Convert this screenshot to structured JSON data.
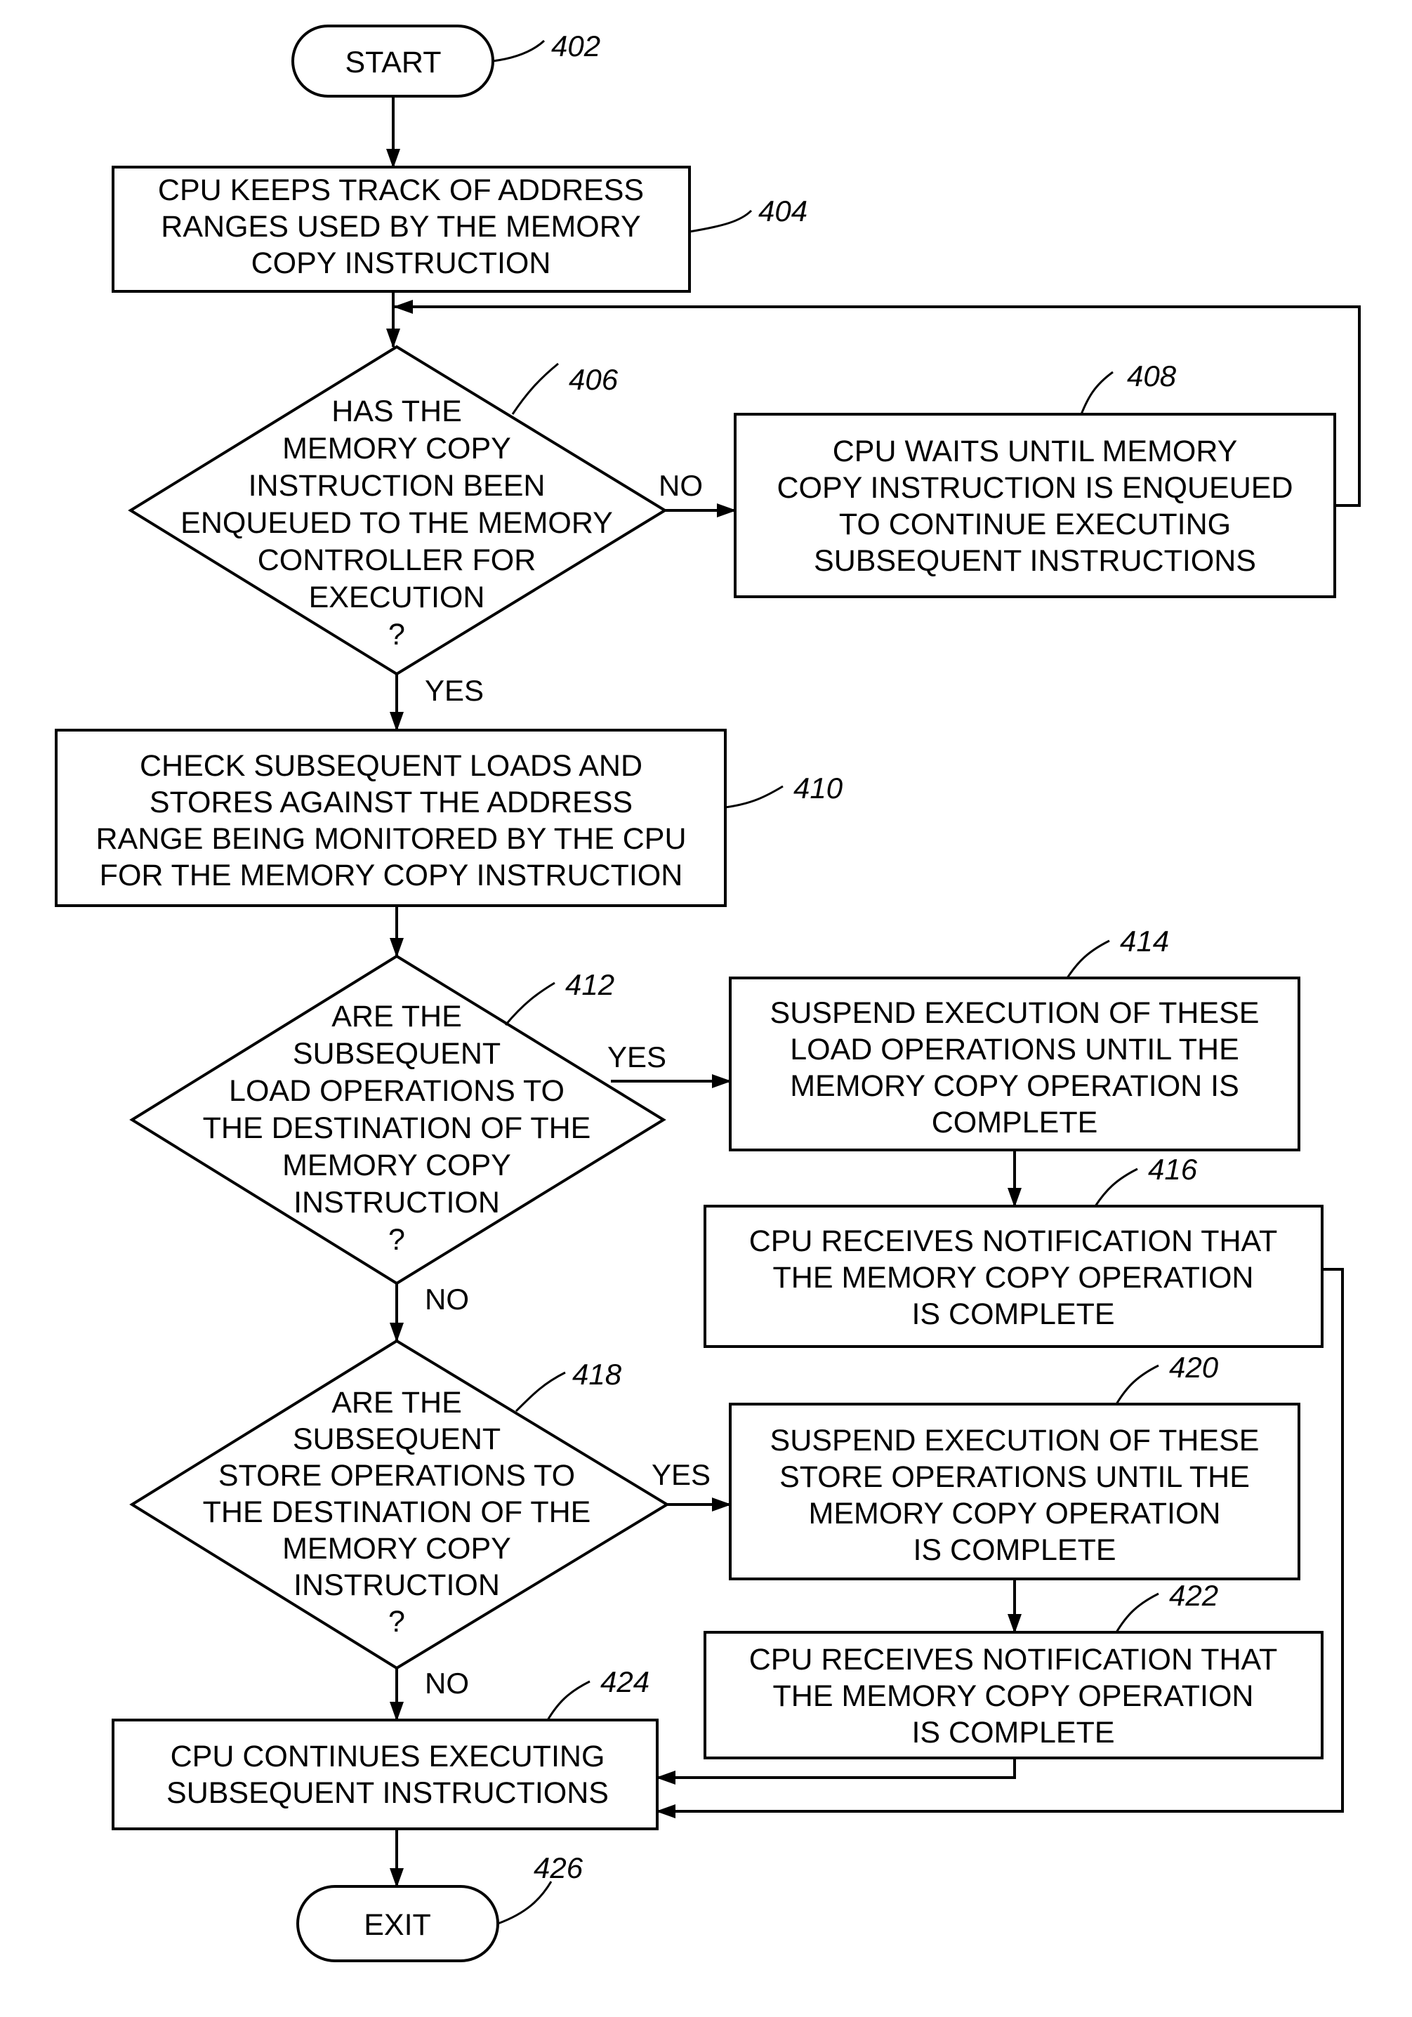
{
  "figure": {
    "nodes": {
      "start": {
        "ref": "402",
        "lines": [
          "START"
        ]
      },
      "track": {
        "ref": "404",
        "lines": [
          "CPU KEEPS TRACK OF ADDRESS",
          "RANGES USED BY THE MEMORY",
          "COPY INSTRUCTION"
        ]
      },
      "enqueued": {
        "ref": "406",
        "lines": [
          "HAS THE",
          "MEMORY COPY",
          "INSTRUCTION BEEN",
          "ENQUEUED TO THE MEMORY",
          "CONTROLLER FOR",
          "EXECUTION",
          "?"
        ]
      },
      "wait": {
        "ref": "408",
        "lines": [
          "CPU WAITS UNTIL MEMORY",
          "COPY INSTRUCTION IS ENQUEUED",
          "TO CONTINUE EXECUTING",
          "SUBSEQUENT INSTRUCTIONS"
        ]
      },
      "check": {
        "ref": "410",
        "lines": [
          "CHECK SUBSEQUENT LOADS AND",
          "STORES AGAINST THE ADDRESS",
          "RANGE BEING MONITORED BY THE CPU",
          "FOR  THE MEMORY COPY INSTRUCTION"
        ]
      },
      "loads": {
        "ref": "412",
        "lines": [
          "ARE THE",
          "SUBSEQUENT",
          "LOAD OPERATIONS TO",
          "THE DESTINATION OF THE",
          "MEMORY COPY",
          "INSTRUCTION",
          "?"
        ]
      },
      "suspend_loads": {
        "ref": "414",
        "lines": [
          "SUSPEND EXECUTION OF THESE",
          "LOAD OPERATIONS UNTIL THE",
          "MEMORY COPY OPERATION IS",
          "COMPLETE"
        ]
      },
      "notify_loads": {
        "ref": "416",
        "lines": [
          "CPU RECEIVES NOTIFICATION THAT",
          "THE MEMORY COPY OPERATION",
          "IS COMPLETE"
        ]
      },
      "stores": {
        "ref": "418",
        "lines": [
          "ARE THE",
          "SUBSEQUENT",
          "STORE OPERATIONS TO",
          "THE DESTINATION OF THE",
          "MEMORY COPY",
          "INSTRUCTION",
          "?"
        ]
      },
      "suspend_stores": {
        "ref": "420",
        "lines": [
          "SUSPEND EXECUTION OF THESE",
          "STORE OPERATIONS UNTIL THE",
          "MEMORY COPY OPERATION",
          "IS COMPLETE"
        ]
      },
      "notify_stores": {
        "ref": "422",
        "lines": [
          "CPU RECEIVES NOTIFICATION THAT",
          "THE MEMORY COPY OPERATION",
          "IS COMPLETE"
        ]
      },
      "continue": {
        "ref": "424",
        "lines": [
          "CPU CONTINUES EXECUTING",
          "SUBSEQUENT INSTRUCTIONS"
        ]
      },
      "exit": {
        "ref": "426",
        "lines": [
          "EXIT"
        ]
      }
    },
    "edge_labels": {
      "enqueued_no": "NO",
      "enqueued_yes": "YES",
      "loads_yes": "YES",
      "loads_no": "NO",
      "stores_yes": "YES",
      "stores_no": "NO"
    }
  }
}
